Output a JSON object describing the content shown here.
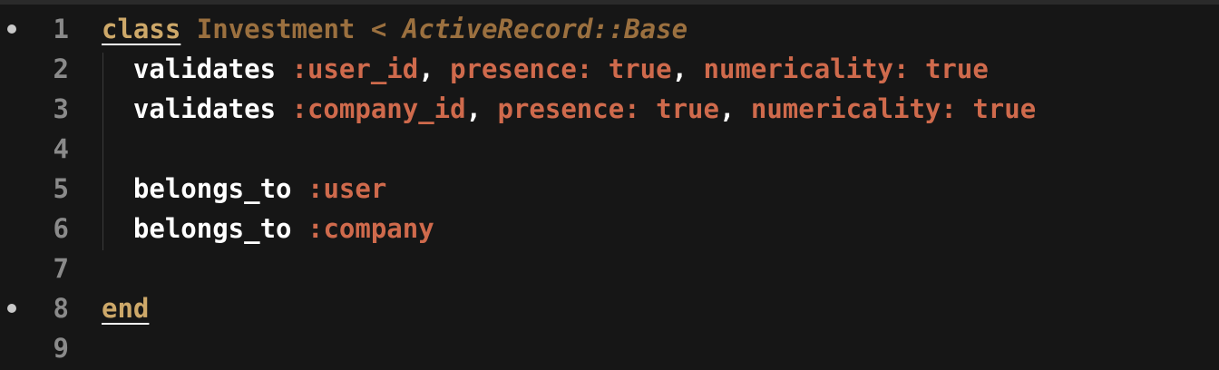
{
  "editor": {
    "lines": [
      {
        "number": "1",
        "marker": true,
        "t1": "class",
        "t2": " ",
        "t3": "Investment",
        "t4": " < ",
        "t5": "ActiveRecord::Base"
      },
      {
        "number": "2",
        "marker": false,
        "t1": "  validates ",
        "t2": ":user_id",
        "t3": ", ",
        "t4": "presence:",
        "t5": " ",
        "t6": "true",
        "t7": ", ",
        "t8": "numericality:",
        "t9": " ",
        "t10": "true"
      },
      {
        "number": "3",
        "marker": false,
        "t1": "  validates ",
        "t2": ":company_id",
        "t3": ", ",
        "t4": "presence:",
        "t5": " ",
        "t6": "true",
        "t7": ", ",
        "t8": "numericality:",
        "t9": " ",
        "t10": "true"
      },
      {
        "number": "4",
        "marker": false
      },
      {
        "number": "5",
        "marker": false,
        "t1": "  belongs_to ",
        "t2": ":user"
      },
      {
        "number": "6",
        "marker": false,
        "t1": "  belongs_to ",
        "t2": ":company"
      },
      {
        "number": "7",
        "marker": false
      },
      {
        "number": "8",
        "marker": true,
        "t1": "end"
      },
      {
        "number": "9",
        "marker": false
      }
    ],
    "colors": {
      "background": "#161616",
      "keyword": "#cda869",
      "class_name": "#9b703f",
      "symbol": "#cf6a4c",
      "identifier": "#ffffff",
      "line_number": "#8a8a8a"
    }
  }
}
